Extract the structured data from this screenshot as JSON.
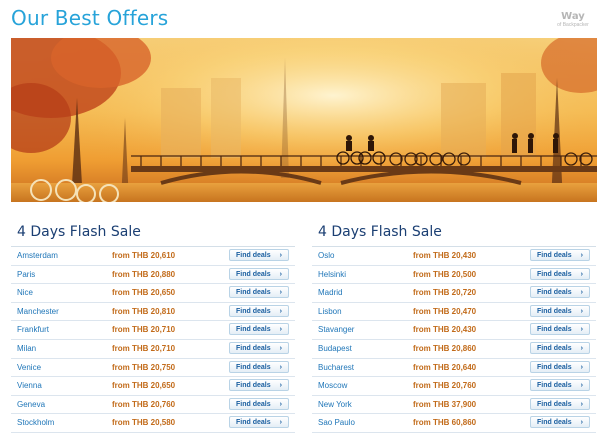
{
  "page_title": "Our Best Offers",
  "logo": {
    "big": "Way",
    "small": "of Backpacker"
  },
  "hero": {
    "scene": "autumn canal bridge with cyclists in golden sunlight"
  },
  "colors": {
    "title": "#27a3d9",
    "price": "#c26b1a",
    "city": "#1f76b8",
    "panel_title": "#1b3f73"
  },
  "left_panel": {
    "title": "4 Days Flash Sale",
    "button_label": "Find deals",
    "chevron": "›",
    "rows": [
      {
        "city": "Amsterdam",
        "price": "from THB 20,610"
      },
      {
        "city": "Paris",
        "price": "from THB 20,880"
      },
      {
        "city": "Nice",
        "price": "from THB 20,650"
      },
      {
        "city": "Manchester",
        "price": "from THB 20,810"
      },
      {
        "city": "Frankfurt",
        "price": "from THB 20,710"
      },
      {
        "city": "Milan",
        "price": "from THB 20,710"
      },
      {
        "city": "Venice",
        "price": "from THB 20,750"
      },
      {
        "city": "Vienna",
        "price": "from THB 20,650"
      },
      {
        "city": "Geneva",
        "price": "from THB 20,760"
      },
      {
        "city": "Stockholm",
        "price": "from THB 20,580"
      }
    ]
  },
  "right_panel": {
    "title": "4 Days Flash Sale",
    "button_label": "Find deals",
    "chevron": "›",
    "rows": [
      {
        "city": "Oslo",
        "price": "from THB 20,430"
      },
      {
        "city": "Helsinki",
        "price": "from THB 20,500"
      },
      {
        "city": "Madrid",
        "price": "from THB 20,720"
      },
      {
        "city": "Lisbon",
        "price": "from THB 20,470"
      },
      {
        "city": "Stavanger",
        "price": "from THB 20,430"
      },
      {
        "city": "Budapest",
        "price": "from THB 20,860"
      },
      {
        "city": "Bucharest",
        "price": "from THB 20,640"
      },
      {
        "city": "Moscow",
        "price": "from THB 20,760"
      },
      {
        "city": "New York",
        "price": "from THB 37,900"
      },
      {
        "city": "Sao Paulo",
        "price": "from THB 60,860"
      }
    ]
  }
}
